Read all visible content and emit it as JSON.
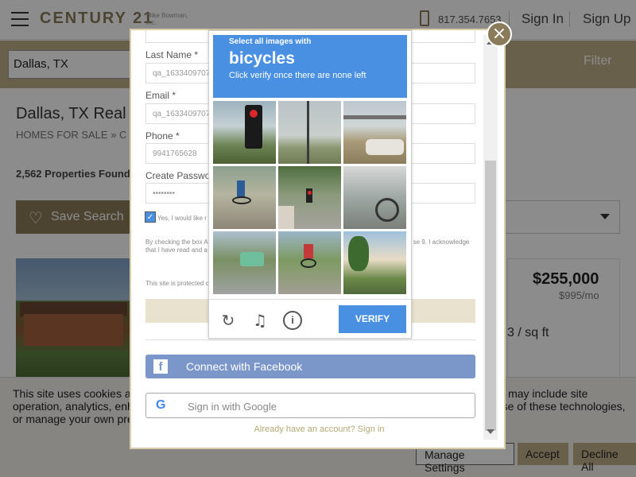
{
  "header": {
    "logo": "CENTURY 21",
    "logo_sub": "Mike Bowman, Inc.",
    "phone": "817.354.7653",
    "sign_in": "Sign In",
    "sign_up": "Sign Up"
  },
  "search": {
    "value": "Dallas, TX",
    "filter_label": "Filter"
  },
  "page": {
    "title": "Dallas, TX Real",
    "breadcrumb": "HOMES FOR SALE  »  C",
    "count": "2,562 Properties Found",
    "save_search": "Save Search"
  },
  "listing": {
    "price": "$255,000",
    "rent": "$995/mo",
    "per_sqft": "3 / sq ft"
  },
  "cookie": {
    "text": "This site uses cookies and related technologies, as described in our privacy policy, for purposes that may include site operation, analytics, enhanced user experience, or advertising. You may choose to consent to our use of these technologies, or manage your own preferences.",
    "manage": "Manage Settings",
    "accept": "Accept",
    "decline": "Decline All"
  },
  "modal": {
    "last_name_label": "Last Name *",
    "last_name_value": "qa_1633409707",
    "email_label": "Email *",
    "email_value": "qa_1633409707",
    "phone_label": "Phone *",
    "phone_value": "9941765628",
    "password_label": "Create Password",
    "password_value": "••••••••",
    "consent_text": "Yes, I would like r                                                                                               share my information with a C                                                                                           eeds.",
    "terms_text": "By checking the box                                                                                        Agent may contact me by phone or text                                                                                  , and that I can access real estate se                                                                                9. I acknowledge that I have read and a",
    "recaptcha_text": "This site is protected                                                                                                     ce apply.",
    "facebook": "Connect with Facebook",
    "google": "Sign in with Google",
    "already": "Already have an account? Sign in"
  },
  "captcha": {
    "instruction": "Select all images with",
    "target": "bicycles",
    "hint": "Click verify once there are none left",
    "verify": "VERIFY"
  },
  "colors": {
    "brand_gold": "#beaf87",
    "brand_dark_gold": "#8a7b5a",
    "captcha_blue": "#4a90e2",
    "facebook_blue": "#7b97c9"
  },
  "icons": [
    "hamburger-icon",
    "phone-icon",
    "heart-icon",
    "close-icon",
    "facebook-icon",
    "google-icon",
    "reload-icon",
    "audio-icon",
    "info-icon",
    "chevron-down-icon"
  ]
}
